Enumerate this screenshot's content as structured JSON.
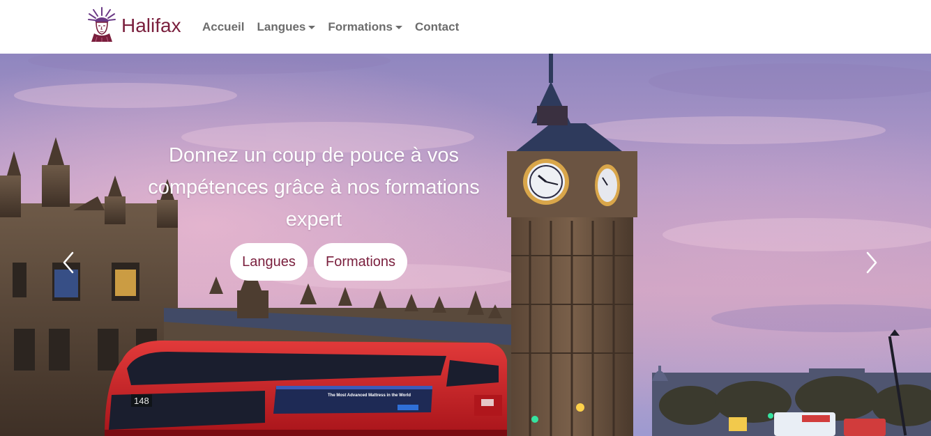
{
  "brand": {
    "name": "Halifax",
    "logo_icon": "statue-of-liberty-icon"
  },
  "nav": {
    "items": [
      {
        "label": "Accueil",
        "dropdown": false
      },
      {
        "label": "Langues",
        "dropdown": true
      },
      {
        "label": "Formations",
        "dropdown": true
      },
      {
        "label": "Contact",
        "dropdown": false
      }
    ]
  },
  "hero": {
    "headline_line1": "Donnez un coup de pouce à vos",
    "headline_line2": "compétences grâce à nos formations",
    "headline_line3": "expert",
    "buttons": {
      "langues": "Langues",
      "formations": "Formations"
    },
    "background": "london-big-ben-bus-photo",
    "bus_number": "148",
    "bus_ad_text": "The Most Advanced Mattress in the World",
    "prev_icon": "chevron-left-icon",
    "next_icon": "chevron-right-icon"
  },
  "colors": {
    "accent": "#7a1f3d",
    "nav_text": "#6c6c6c",
    "white": "#ffffff"
  }
}
